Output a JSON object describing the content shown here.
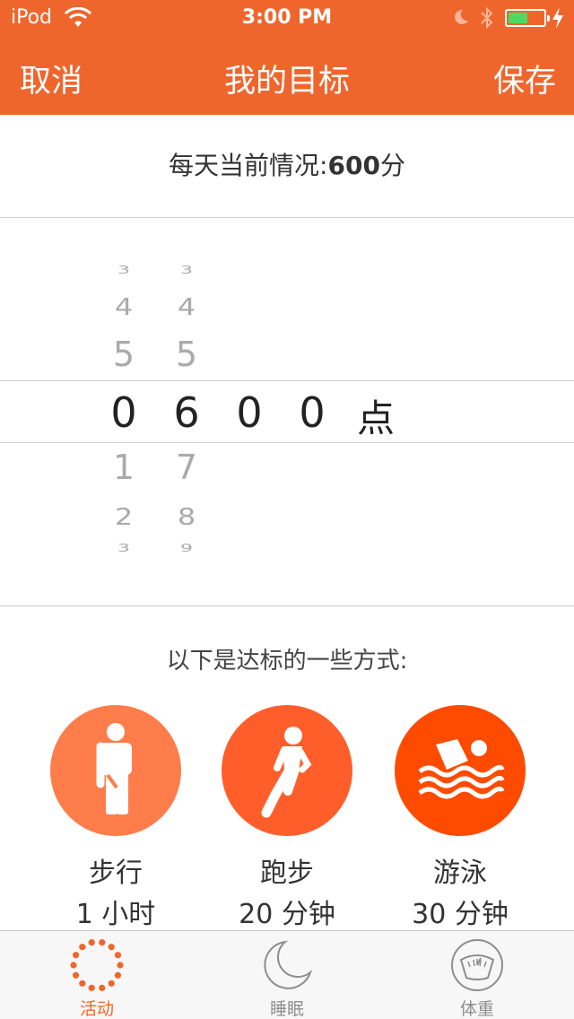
{
  "status_bar": {
    "carrier": "iPod",
    "time": "3:00 PM",
    "battery_level": 0.55
  },
  "nav": {
    "cancel": "取消",
    "title": "我的目标",
    "save": "保存"
  },
  "current": {
    "label": "每天当前情况:",
    "value": "600",
    "unit": "分"
  },
  "picker": {
    "columns": [
      {
        "above": [
          "3",
          "4",
          "5"
        ],
        "selected": "0",
        "below": [
          "1",
          "2",
          "3"
        ]
      },
      {
        "above": [
          "3",
          "4",
          "5"
        ],
        "selected": "6",
        "below": [
          "7",
          "8",
          "9"
        ]
      },
      {
        "above": [],
        "selected": "0",
        "below": []
      },
      {
        "above": [],
        "selected": "0",
        "below": []
      }
    ],
    "suffix": "点"
  },
  "ways": {
    "title": "以下是达标的一些方式:",
    "items": [
      {
        "name": "步行",
        "duration": "1 小时",
        "icon": "walking-icon",
        "color": "#ff7d4b"
      },
      {
        "name": "跑步",
        "duration": "20 分钟",
        "icon": "running-icon",
        "color": "#ff5e2b"
      },
      {
        "name": "游泳",
        "duration": "30 分钟",
        "icon": "swimming-icon",
        "color": "#ff4b00"
      }
    ]
  },
  "tabs": [
    {
      "label": "活动",
      "icon": "activity-dots-icon",
      "active": true
    },
    {
      "label": "睡眠",
      "icon": "moon-icon",
      "active": false
    },
    {
      "label": "体重",
      "icon": "scale-icon",
      "active": false
    }
  ],
  "colors": {
    "accent": "#ef662d",
    "walk": "#ff7d4b",
    "run": "#ff5e2b",
    "swim": "#ff4b00"
  }
}
